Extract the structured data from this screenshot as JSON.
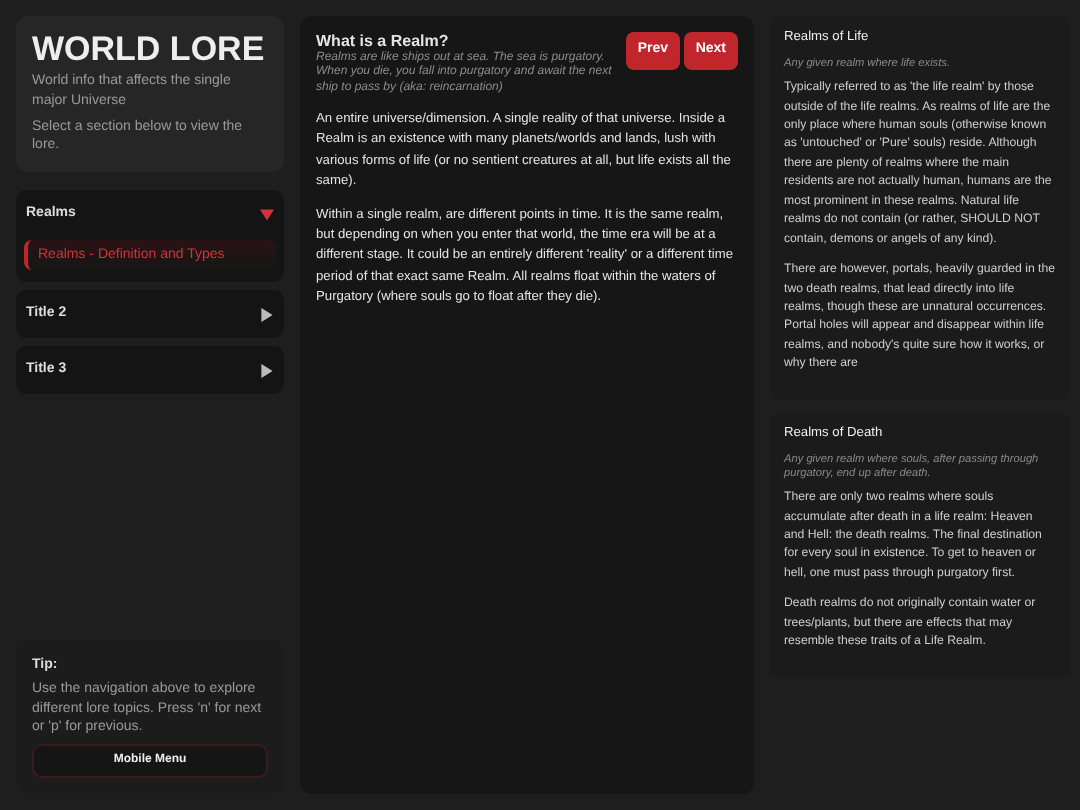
{
  "header": {
    "title": "WORLD LORE",
    "subtitle": "World info that affects the single major Universe",
    "hint": "Select a section below to view the lore."
  },
  "sections": [
    {
      "title": "Realms",
      "expanded": true,
      "items": [
        {
          "label": "Realms - Definition and Types",
          "selected": true
        }
      ]
    },
    {
      "title": "Title 2",
      "expanded": false
    },
    {
      "title": "Title 3",
      "expanded": false
    }
  ],
  "tip": {
    "title": "Tip:",
    "text": "Use the navigation above to explore different lore topics. Press 'n' for next or 'p' for previous.",
    "button": "Mobile Menu"
  },
  "article": {
    "title": "What is a Realm?",
    "subtitle": "Realms are like ships out at sea. The sea is purgatory. When you die, you fall into purgatory and await the next ship to pass by (aka: reincarnation)",
    "buttons": [
      "Prev",
      "Next"
    ],
    "paragraphs": [
      "An entire universe/dimension. A single reality of that universe. Inside a Realm is an existence with many planets/worlds and lands, lush with various forms of life (or no sentient creatures at all, but life exists all the same).",
      "Within a single realm, are different points in time. It is the same realm, but depending on when you enter that world, the time era will be at a different stage. It could be an entirely different 'reality' or a different time period of that exact same Realm. All realms float within the waters of Purgatory (where souls go to float after they die)."
    ]
  },
  "side_cards": [
    {
      "title": "Realms of Life",
      "subtitle": "Any given realm where life exists.",
      "paragraphs": [
        "Typically referred to as 'the life realm' by those outside of the life realms. As realms of life are the only place where human souls (otherwise known as 'untouched' or 'Pure' souls) reside. Although there are plenty of realms where the main residents are not actually human, humans are the most prominent in these realms. Natural life realms do not contain (or rather, SHOULD NOT contain, demons or angels of any kind).",
        "There are however, portals, heavily guarded in the two death realms, that lead directly into life realms, though these are unnatural occurrences. Portal holes will appear and disappear within life realms, and nobody's quite sure how it works, or why there are"
      ]
    },
    {
      "title": "Realms of Death",
      "subtitle": "Any given realm where souls, after passing through purgatory, end up after death.",
      "paragraphs": [
        "There are only two realms where souls accumulate after death in a life realm: Heaven and Hell: the death realms. The final destination for every soul in existence. To get to heaven or hell, one must pass through purgatory first.",
        "Death realms do not originally contain water or trees/plants, but there are effects that may resemble these traits of a Life Realm."
      ]
    }
  ]
}
